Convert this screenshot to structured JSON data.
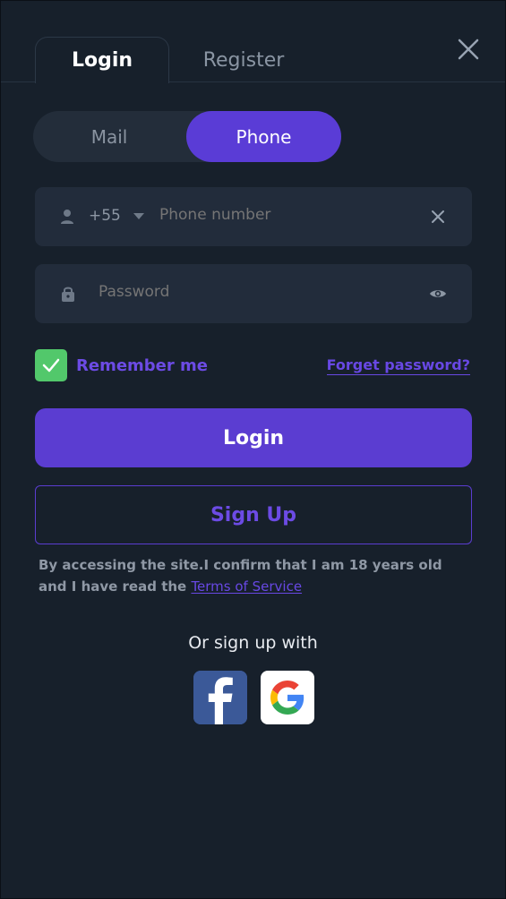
{
  "tabs": {
    "login": "Login",
    "register": "Register"
  },
  "segmented": {
    "mail": "Mail",
    "phone": "Phone"
  },
  "phone_field": {
    "country_code": "+55",
    "placeholder": "Phone number"
  },
  "password_field": {
    "placeholder": "Password"
  },
  "remember_me": "Remember me",
  "forgot_password": "Forget password?",
  "buttons": {
    "login": "Login",
    "signup": "Sign Up"
  },
  "disclaimer": {
    "text": "By accessing the site.I confirm that I am 18 years old and I have read the ",
    "terms": "Terms of Service"
  },
  "social": {
    "heading": "Or sign up with",
    "facebook_icon": "facebook-icon",
    "google_icon": "google-icon"
  },
  "colors": {
    "background": "#17202b",
    "panel": "#222c3b",
    "accent": "#5b3dd1",
    "success": "#52c86b"
  }
}
